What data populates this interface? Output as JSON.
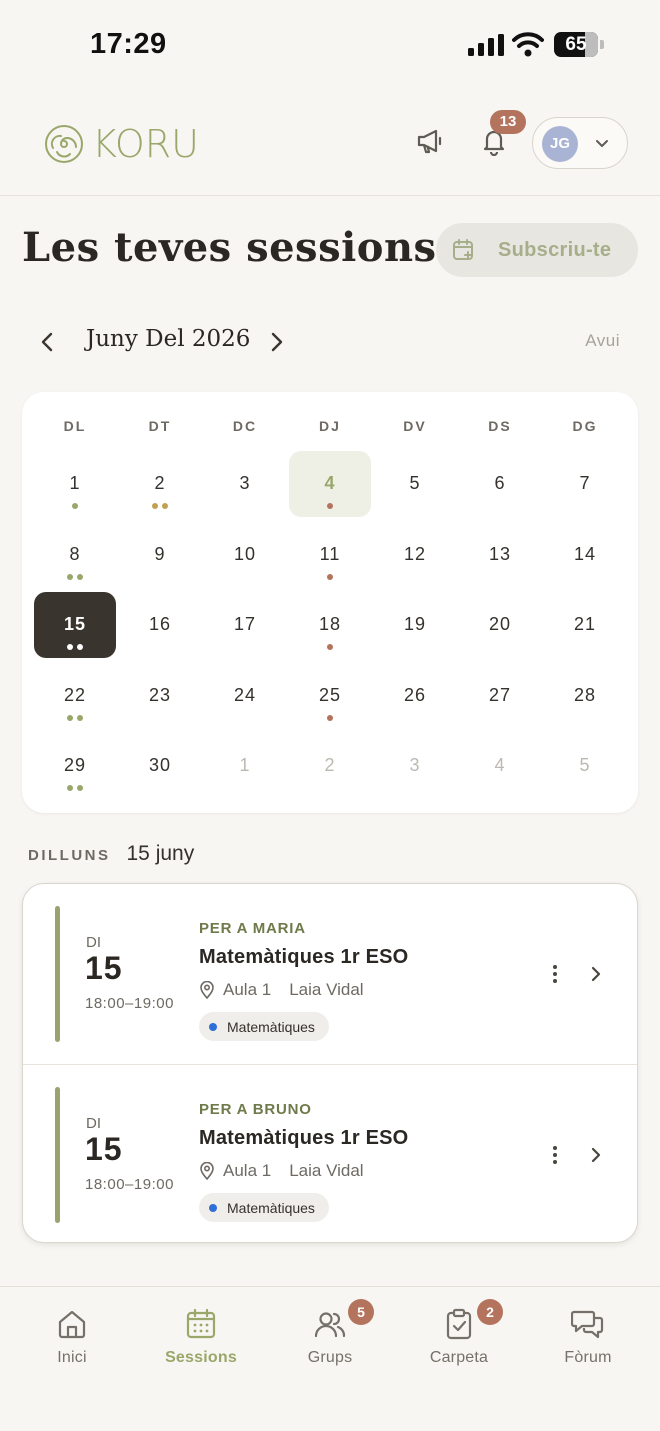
{
  "status_bar": {
    "time": "17:29",
    "battery": "65"
  },
  "header": {
    "logo_text": "KORU",
    "notifications_count": "13",
    "user_initials": "JG"
  },
  "page": {
    "title": "Les teves sessions",
    "subscribe_label": "Subscriu-te"
  },
  "calendar": {
    "month_label": "Juny Del 2026",
    "today_label": "Avui",
    "weekdays": [
      "DL",
      "DT",
      "DC",
      "DJ",
      "DV",
      "DS",
      "DG"
    ],
    "dot_colors": {
      "green": "#9aa76b",
      "gold": "#c2a052",
      "rose": "#b4735d",
      "white": "#ffffff"
    },
    "weeks": [
      [
        {
          "n": "1",
          "dots": [
            "green"
          ]
        },
        {
          "n": "2",
          "dots": [
            "gold",
            "gold"
          ]
        },
        {
          "n": "3",
          "dots": []
        },
        {
          "n": "4",
          "dots": [
            "rose"
          ],
          "state": "hl"
        },
        {
          "n": "5",
          "dots": []
        },
        {
          "n": "6",
          "dots": []
        },
        {
          "n": "7",
          "dots": []
        }
      ],
      [
        {
          "n": "8",
          "dots": [
            "green",
            "green"
          ]
        },
        {
          "n": "9",
          "dots": []
        },
        {
          "n": "10",
          "dots": []
        },
        {
          "n": "11",
          "dots": [
            "rose"
          ]
        },
        {
          "n": "12",
          "dots": []
        },
        {
          "n": "13",
          "dots": []
        },
        {
          "n": "14",
          "dots": []
        }
      ],
      [
        {
          "n": "15",
          "dots": [
            "white",
            "white"
          ],
          "state": "sel"
        },
        {
          "n": "16",
          "dots": []
        },
        {
          "n": "17",
          "dots": []
        },
        {
          "n": "18",
          "dots": [
            "rose"
          ]
        },
        {
          "n": "19",
          "dots": []
        },
        {
          "n": "20",
          "dots": []
        },
        {
          "n": "21",
          "dots": []
        }
      ],
      [
        {
          "n": "22",
          "dots": [
            "green",
            "green"
          ]
        },
        {
          "n": "23",
          "dots": []
        },
        {
          "n": "24",
          "dots": []
        },
        {
          "n": "25",
          "dots": [
            "rose"
          ]
        },
        {
          "n": "26",
          "dots": []
        },
        {
          "n": "27",
          "dots": []
        },
        {
          "n": "28",
          "dots": []
        }
      ],
      [
        {
          "n": "29",
          "dots": [
            "green",
            "green"
          ]
        },
        {
          "n": "30",
          "dots": []
        },
        {
          "n": "1",
          "dots": [],
          "state": "other"
        },
        {
          "n": "2",
          "dots": [],
          "state": "other"
        },
        {
          "n": "3",
          "dots": [],
          "state": "other"
        },
        {
          "n": "4",
          "dots": [],
          "state": "other"
        },
        {
          "n": "5",
          "dots": [],
          "state": "other"
        }
      ]
    ]
  },
  "selected_date": {
    "day_name": "DILLUNS",
    "date": "15 juny"
  },
  "sessions": [
    {
      "for": "PER A MARIA",
      "day_of_week": "DI",
      "day": "15",
      "hours": "18:00–19:00",
      "title": "Matemàtiques 1r ESO",
      "room": "Aula 1",
      "teacher": "Laia Vidal",
      "tag": "Matemàtiques",
      "tag_color": "#2f6fd8"
    },
    {
      "for": "PER A BRUNO",
      "day_of_week": "DI",
      "day": "15",
      "hours": "18:00–19:00",
      "title": "Matemàtiques 1r ESO",
      "room": "Aula 1",
      "teacher": "Laia Vidal",
      "tag": "Matemàtiques",
      "tag_color": "#2f6fd8"
    }
  ],
  "bottom_nav": [
    {
      "label": "Inici",
      "icon": "home-icon"
    },
    {
      "label": "Sessions",
      "icon": "calendar-icon",
      "active": true
    },
    {
      "label": "Grups",
      "icon": "users-icon",
      "badge": "5"
    },
    {
      "label": "Carpeta",
      "icon": "clipboard-icon",
      "badge": "2"
    },
    {
      "label": "Fòrum",
      "icon": "chat-icon"
    }
  ]
}
